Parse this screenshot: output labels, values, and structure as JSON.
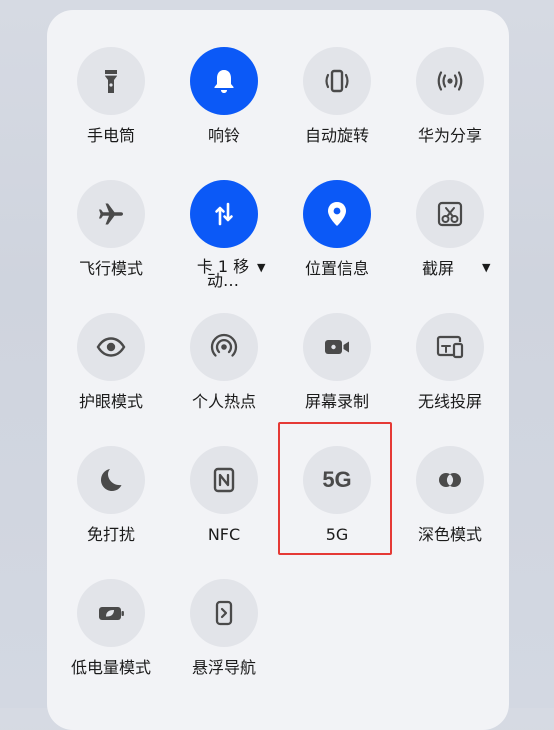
{
  "tiles": {
    "flashlight": "手电筒",
    "ring": "响铃",
    "autorotate": "自动旋转",
    "huawei_share": "华为分享",
    "airplane": "飞行模式",
    "sim": "卡 1 移 动…",
    "location": "位置信息",
    "screenshot": "截屏",
    "eye_comfort": "护眼模式",
    "hotspot": "个人热点",
    "screen_record": "屏幕录制",
    "wireless_projection": "无线投屏",
    "dnd": "免打扰",
    "nfc": "NFC",
    "fiveg": "5G",
    "dark_mode": "深色模式",
    "power_saving": "低电量模式",
    "floating_nav": "悬浮导航"
  },
  "icons": {
    "nfc_glyph": "N",
    "fiveg_glyph": "5G"
  },
  "state": {
    "active_color": "#0b59f7",
    "inactive_color": "#e2e4e9",
    "highlight_color": "#e53935",
    "highlighted_tile": "5G"
  }
}
